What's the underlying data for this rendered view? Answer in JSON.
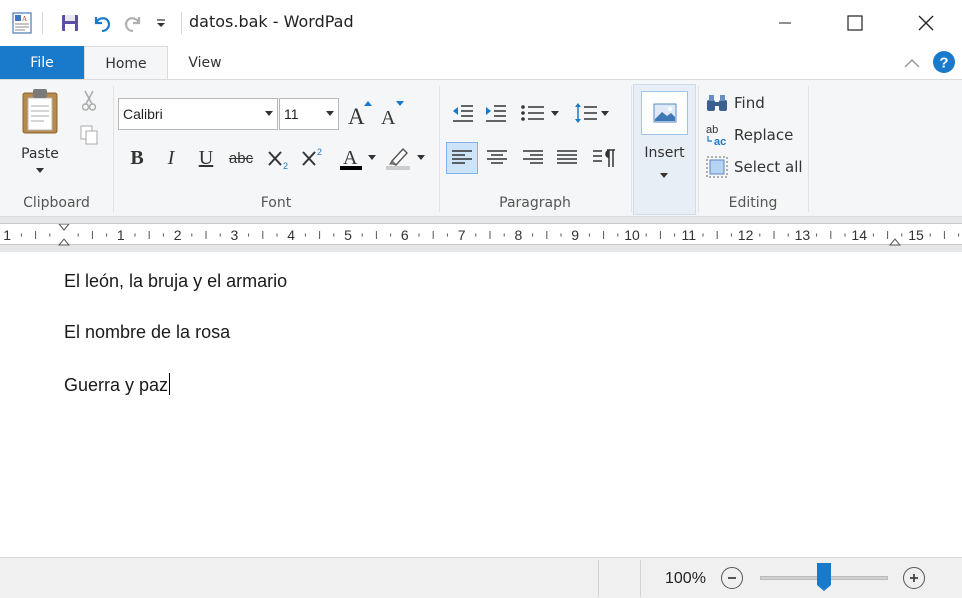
{
  "window": {
    "title": "datos.bak - WordPad"
  },
  "tabs": {
    "file": "File",
    "home": "Home",
    "view": "View"
  },
  "clipboard": {
    "paste_label": "Paste",
    "group_label": "Clipboard"
  },
  "font": {
    "family": "Calibri",
    "size": "11",
    "group_label": "Font"
  },
  "paragraph": {
    "group_label": "Paragraph"
  },
  "insert": {
    "label": "Insert"
  },
  "editing": {
    "find": "Find",
    "replace": "Replace",
    "select_all": "Select all",
    "group_label": "Editing"
  },
  "ruler": {
    "numbers": [
      "1",
      "1",
      "2",
      "3",
      "4",
      "5",
      "6",
      "7",
      "8",
      "9",
      "10",
      "11",
      "12",
      "13",
      "14",
      "15"
    ]
  },
  "document": {
    "paragraphs": [
      "El león, la bruja y el armario",
      "El nombre de la rosa",
      "Guerra y paz"
    ]
  },
  "status": {
    "zoom": "100%",
    "zoom_fraction": 0.5
  },
  "colors": {
    "accent": "#1979ca",
    "font_color": "#000000",
    "highlight": "#cccccc"
  }
}
